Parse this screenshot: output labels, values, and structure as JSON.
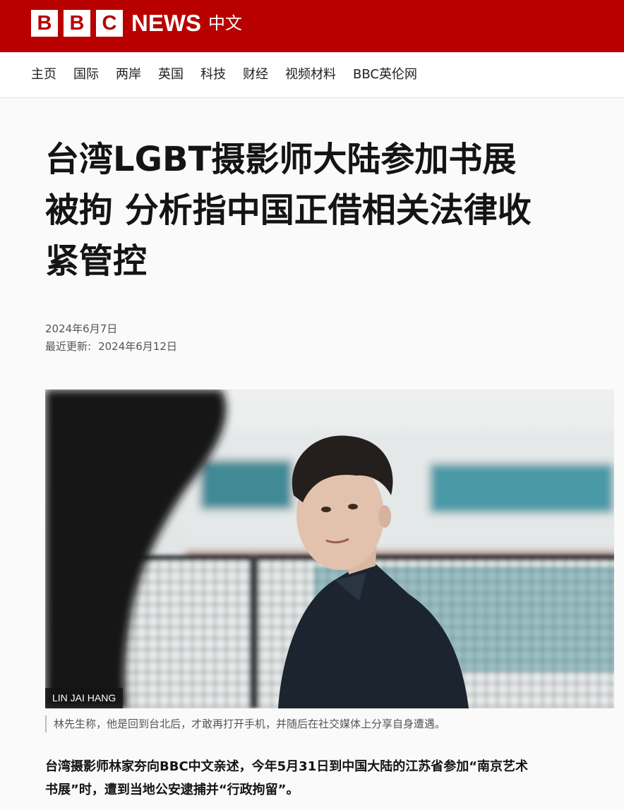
{
  "masthead": {
    "logo_letters": [
      "B",
      "B",
      "C"
    ],
    "news_label": "NEWS",
    "chinese_label": "中文",
    "brand_color": "#b80000"
  },
  "nav": {
    "items": [
      {
        "label": "主页"
      },
      {
        "label": "国际"
      },
      {
        "label": "两岸"
      },
      {
        "label": "英国"
      },
      {
        "label": "科技"
      },
      {
        "label": "财经"
      },
      {
        "label": "视频材料"
      },
      {
        "label": "BBC英伦网"
      }
    ]
  },
  "article": {
    "headline_lines": [
      "台湾LGBT摄影师大陆参加书展",
      "被拘 分析指中国正借相关法律收",
      "紧管控"
    ],
    "published": "2024年6月7日",
    "updated_label": "最近更新:",
    "updated": "2024年6月12日",
    "image_credit": "LIN JAI HANG",
    "image_caption": "林先生称，他是回到台北后，才敢再打开手机，并随后在社交媒体上分享自身遭遇。",
    "lede_lines": [
      "台湾摄影师林家夯向BBC中文亲述，今年5月31日到中国大陆的江苏省参加“南京艺术",
      "书展”时，遭到当地公安逮捕并“行政拘留”。"
    ]
  }
}
